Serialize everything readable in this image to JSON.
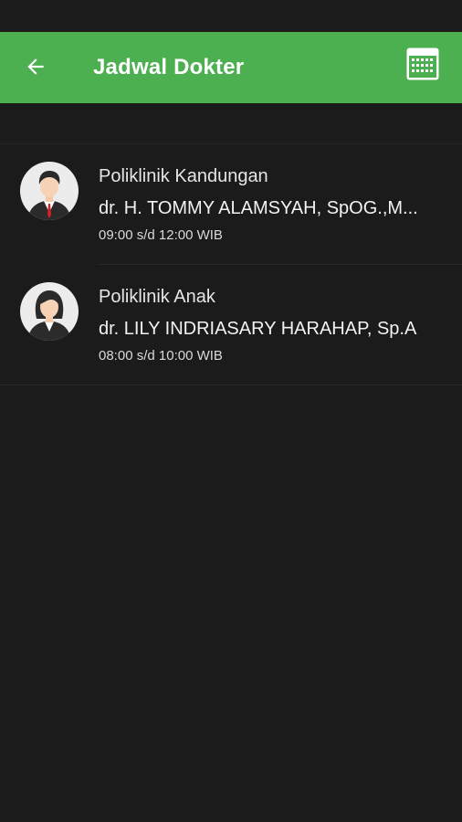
{
  "app_bar": {
    "title": "Jadwal Dokter",
    "back_icon": "arrow-left-icon",
    "calendar_icon": "calendar-icon",
    "color": "#4caf50"
  },
  "schedules": [
    {
      "poli": "Poliklinik Kandungan",
      "doctor": "dr. H. TOMMY ALAMSYAH, SpOG.,M...",
      "time": "09:00 s/d 12:00 WIB",
      "avatar": "male-doctor-avatar-icon"
    },
    {
      "poli": "Poliklinik Anak",
      "doctor": "dr. LILY INDRIASARY HARAHAP, Sp.A",
      "time": "08:00 s/d 10:00 WIB",
      "avatar": "female-doctor-avatar-icon"
    }
  ]
}
